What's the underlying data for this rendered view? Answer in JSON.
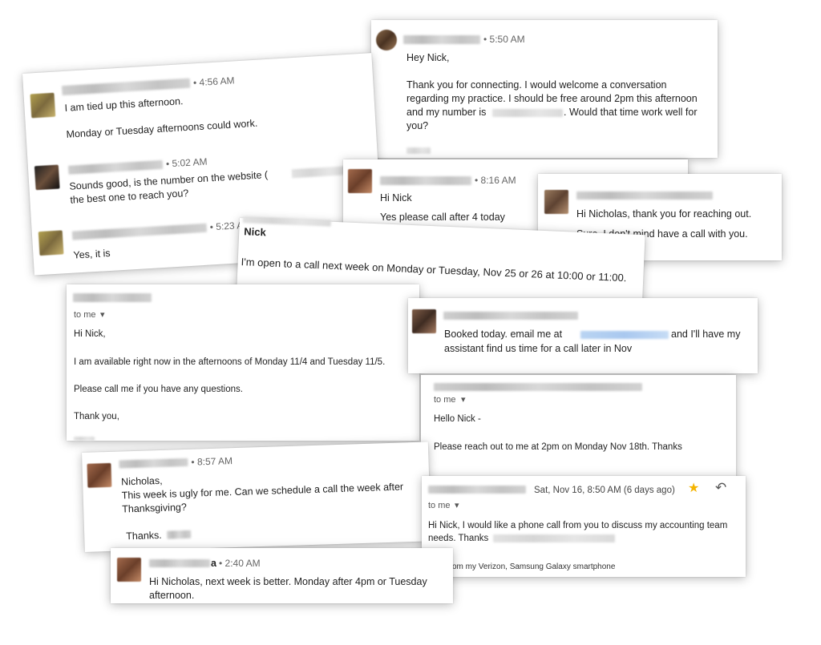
{
  "cards": {
    "c1": {
      "time": "• 5:50 AM",
      "greeting": "Hey Nick,",
      "body_line1": "Thank you for connecting. I would welcome a conversation",
      "body_line2": "regarding my practice. I should be free around 2pm this afternoon",
      "body_line3a": "and my number is",
      "body_line3b": ". Would that time work well for",
      "body_line4": "you?"
    },
    "c2": {
      "time1": "• 4:56 AM",
      "msg1_line1": "I am tied up this afternoon.",
      "msg1_line2": "Monday or Tuesday afternoons could work.",
      "time2": "• 5:02 AM",
      "msg2_line1": "Sounds good, is the number on the website (",
      "msg2_line2": "the best one to reach you?",
      "time3": "• 5:23 AM",
      "msg3": "Yes, it is"
    },
    "c3": {
      "time": "• 8:16 AM",
      "line1": "Hi Nick",
      "line2": "Yes please call after 4 today"
    },
    "c4": {
      "line1": "Hi Nicholas, thank you for reaching out.",
      "line2": "Sure, I don't mind have a call with you."
    },
    "c5": {
      "name": "Nick",
      "body": "I'm open to a call next week on Monday or Tuesday, Nov 25 or 26 at 10:00 or 11:00."
    },
    "c6": {
      "to_me": "to me",
      "caret": "▾",
      "line1": "Hi Nick,",
      "line2": "I am available right now in the afternoons of Monday 11/4 and Tuesday 11/5.",
      "line3": "Please call me if you have any questions.",
      "line4": "Thank you,"
    },
    "c7": {
      "line1a": "Booked today. email me at",
      "line1b": "and I'll have my",
      "line2": "assistant find us time for a call later in Nov"
    },
    "c8": {
      "to_me": "to me",
      "caret": "▾",
      "line1": "Hello Nick -",
      "line2": "Please reach out to me at 2pm on Monday Nov 18th. Thanks"
    },
    "c9": {
      "time": "• 8:57 AM",
      "line1": "Nicholas,",
      "line2": "This week is ugly for me.  Can we schedule a call the week after",
      "line3": "Thanksgiving?",
      "line4": "Thanks."
    },
    "c10": {
      "date": "Sat, Nov 16, 8:50 AM (6 days ago)",
      "to_me": "to me",
      "caret": "▾",
      "line1": "Hi Nick, I would like a phone call from you to discuss my accounting team",
      "line2": "needs. Thanks",
      "sig": "om my Verizon, Samsung Galaxy smartphone"
    },
    "c11": {
      "name_tail": "a",
      "time": "• 2:40 AM",
      "line1": "Hi Nicholas, next week is better. Monday after 4pm or Tuesday",
      "line2": "afternoon."
    }
  }
}
